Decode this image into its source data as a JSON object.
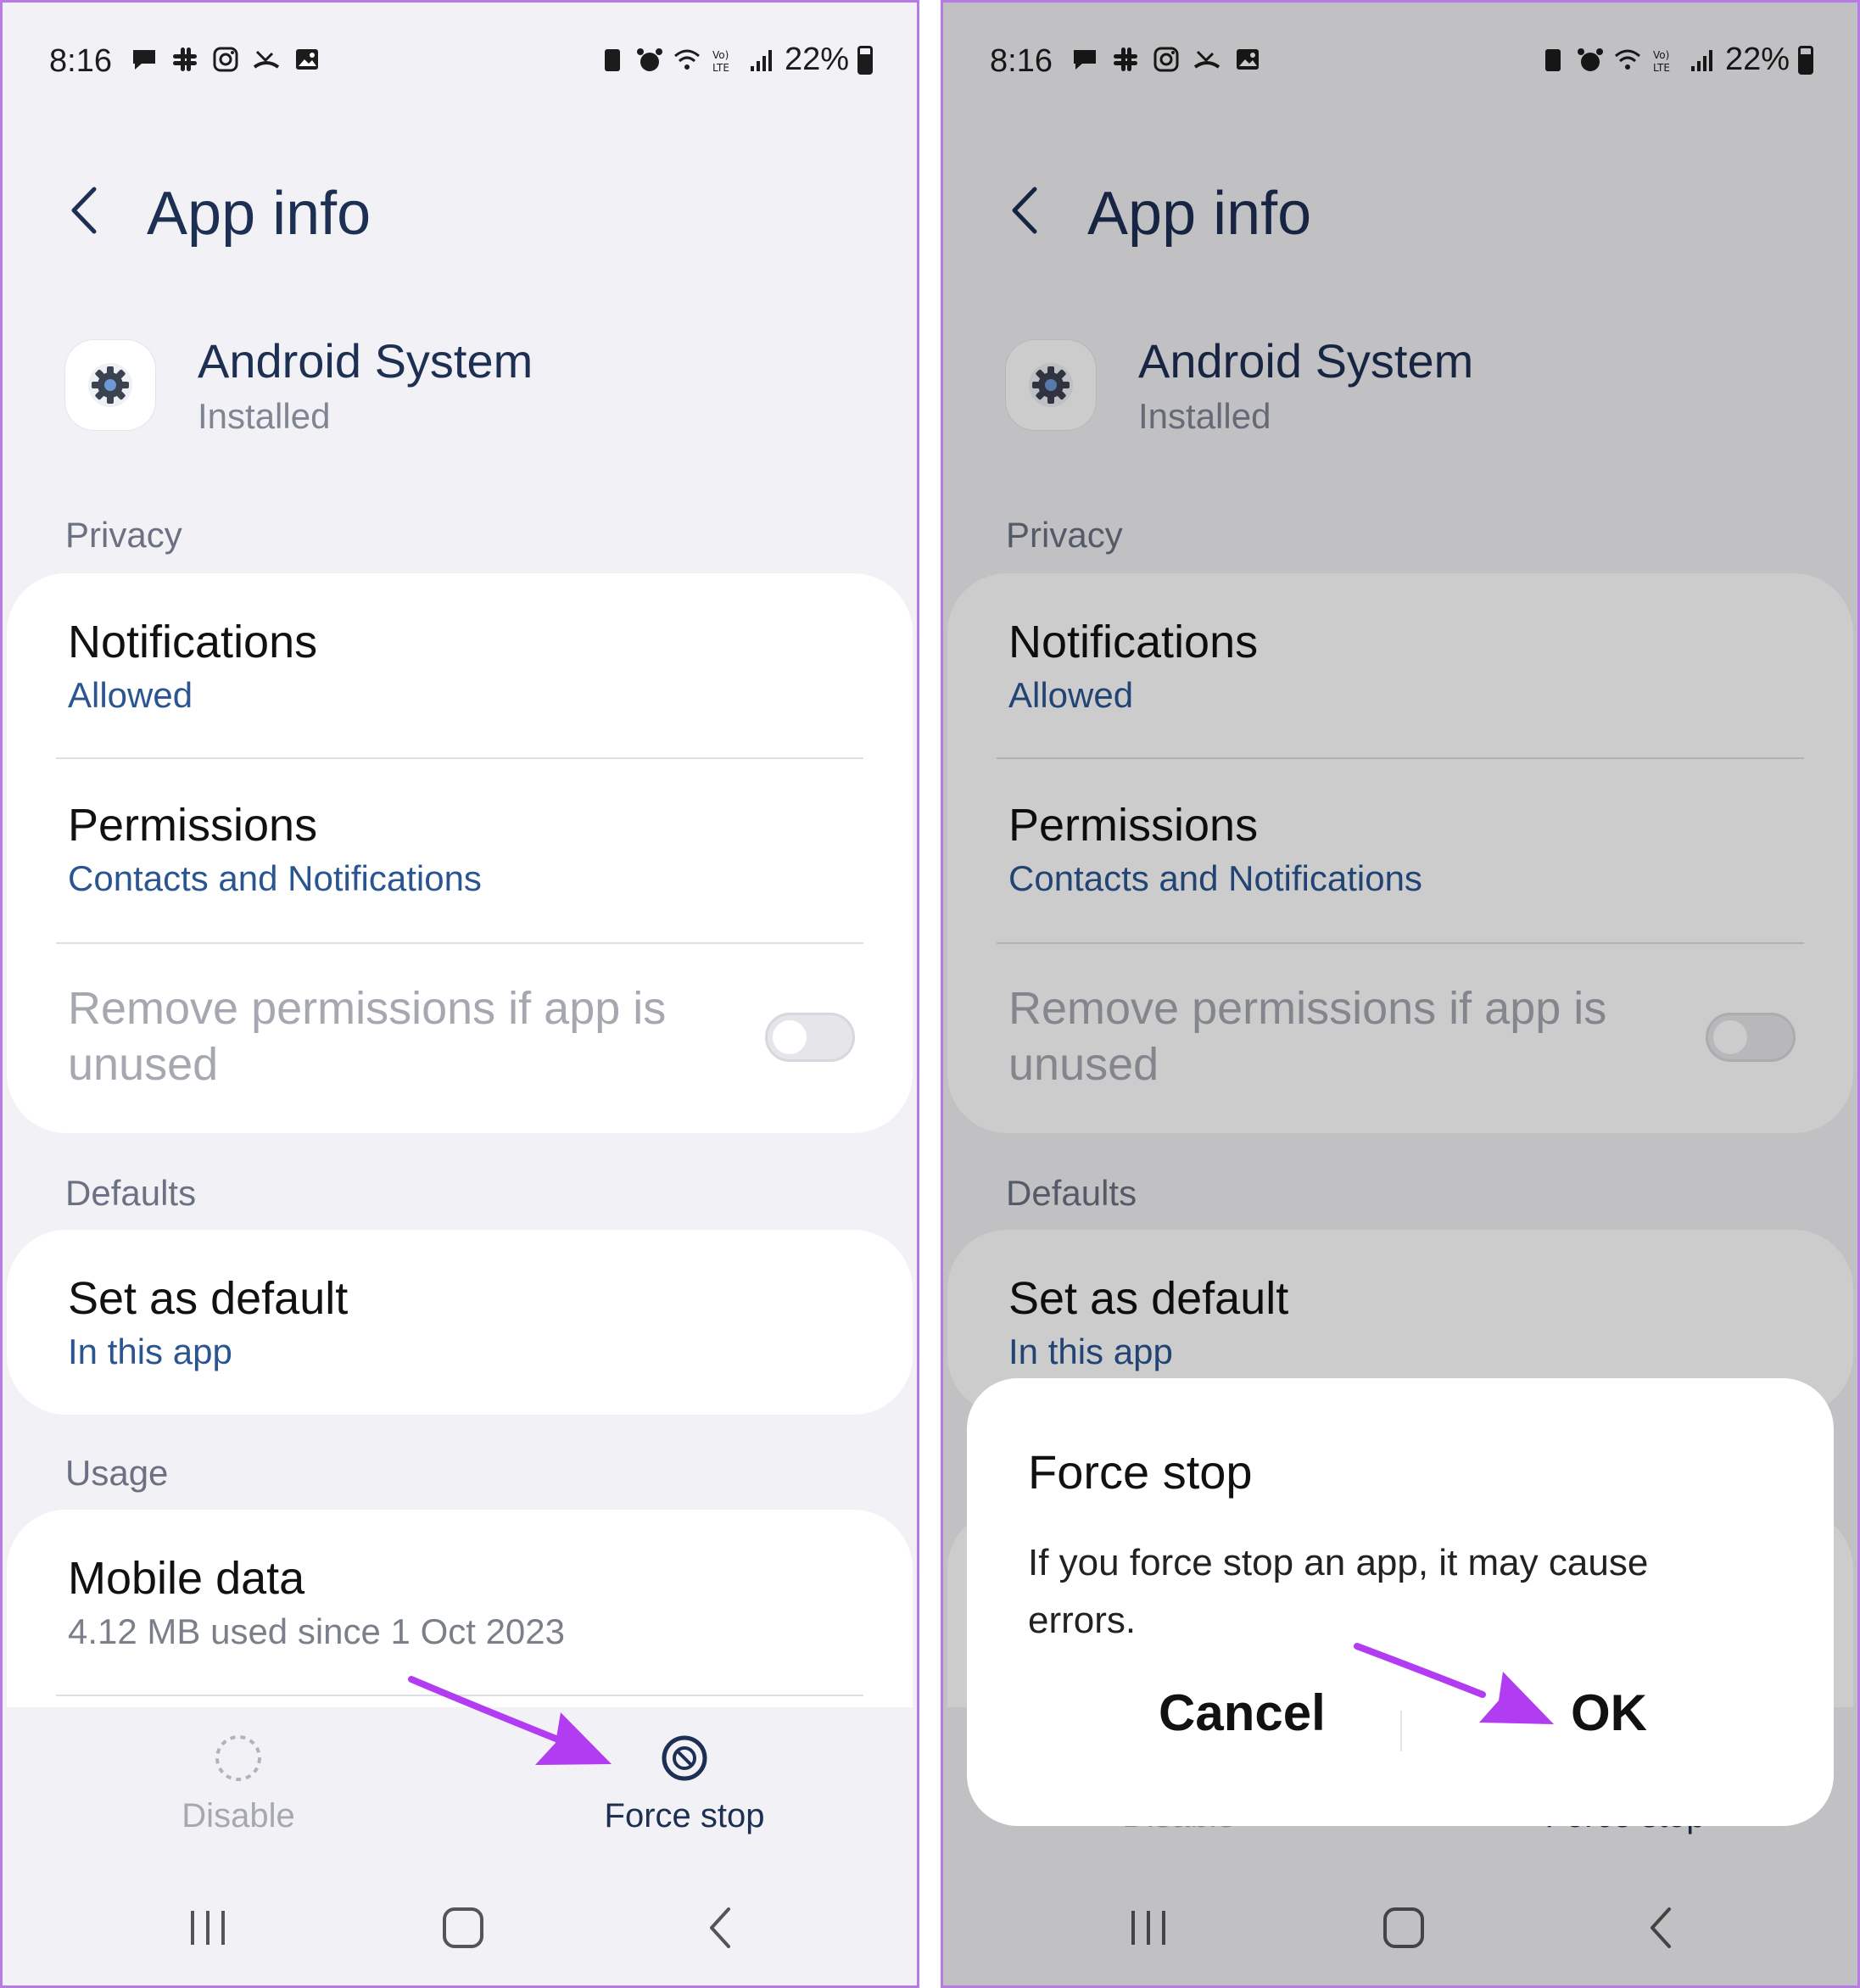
{
  "status": {
    "time": "8:16",
    "battery": "22%"
  },
  "header": {
    "title": "App info"
  },
  "app": {
    "name": "Android System",
    "state": "Installed"
  },
  "sections": {
    "privacy": "Privacy",
    "defaults": "Defaults",
    "usage": "Usage"
  },
  "rows": {
    "notifications": {
      "title": "Notifications",
      "sub": "Allowed"
    },
    "permissions": {
      "title": "Permissions",
      "sub": "Contacts and Notifications"
    },
    "remove_permissions": {
      "title": "Remove permissions if app is unused",
      "enabled": false
    },
    "set_default": {
      "title": "Set as default",
      "sub": "In this app"
    },
    "mobile_data": {
      "title": "Mobile data",
      "sub": "4.12 MB used since 1 Oct 2023"
    }
  },
  "actions": {
    "disable": "Disable",
    "force_stop": "Force stop"
  },
  "dialog": {
    "title": "Force stop",
    "body": "If you force stop an app, it may cause errors.",
    "cancel": "Cancel",
    "ok": "OK"
  },
  "colors": {
    "accent_text": "#2a5591",
    "title_text": "#1d2f53",
    "arrow": "#b23cf2",
    "panel_border": "#b77be6"
  }
}
